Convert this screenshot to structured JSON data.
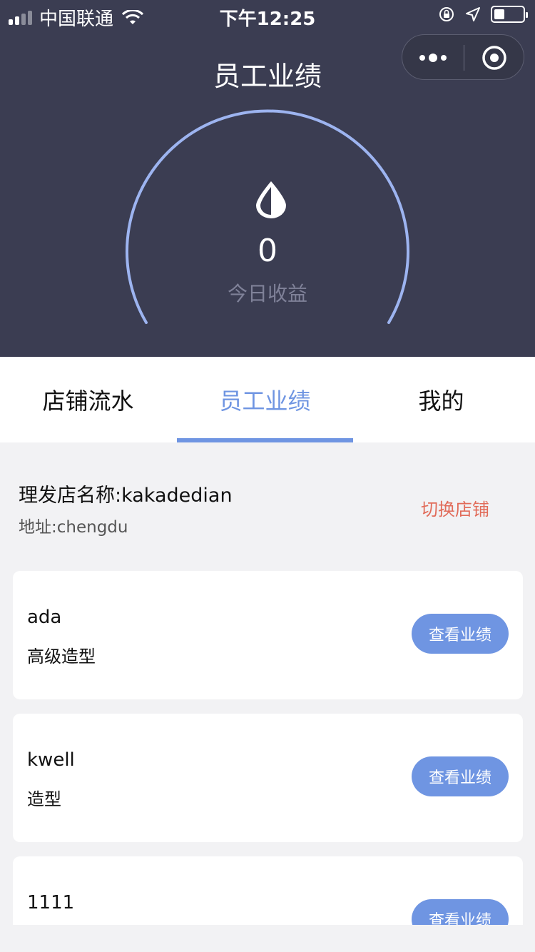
{
  "status_bar": {
    "carrier": "中国联通",
    "time": "下午12:25"
  },
  "header": {
    "title": "员工业绩",
    "today_value": "0",
    "today_label": "今日收益"
  },
  "tabs": [
    {
      "label": "店铺流水",
      "active": false
    },
    {
      "label": "员工业绩",
      "active": true
    },
    {
      "label": "我的",
      "active": false
    }
  ],
  "store": {
    "name": "理发店名称:kakadedian",
    "address": "地址:chengdu",
    "switch_label": "切换店铺"
  },
  "employees": [
    {
      "name": "ada",
      "role": "高级造型",
      "button": "查看业绩"
    },
    {
      "name": "kwell",
      "role": "造型",
      "button": "查看业绩"
    },
    {
      "name": "1111",
      "role": "",
      "button": "查看业绩"
    }
  ],
  "colors": {
    "header_bg": "#3b3d52",
    "accent": "#6f95e2",
    "warning": "#e16c5a"
  }
}
